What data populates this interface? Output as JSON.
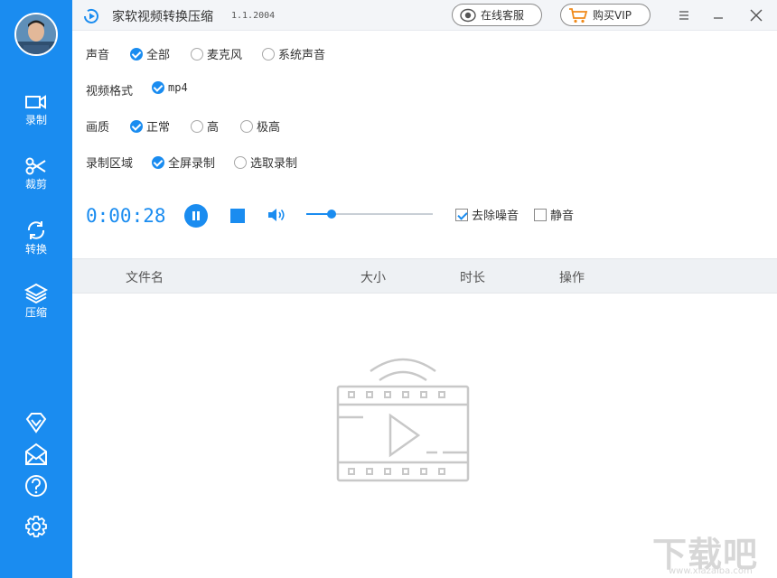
{
  "sidebar": {
    "items": [
      {
        "label": "录制",
        "icon": "camera-icon"
      },
      {
        "label": "裁剪",
        "icon": "scissors-icon"
      },
      {
        "label": "转换",
        "icon": "convert-icon"
      },
      {
        "label": "压缩",
        "icon": "layers-icon"
      }
    ],
    "bottom_icons": [
      "diamond-icon",
      "mail-icon",
      "help-icon",
      "settings-icon"
    ]
  },
  "titlebar": {
    "title": "家软视频转换压缩",
    "version": "1.1.2004",
    "support_button": "在线客服",
    "vip_button": "购买VIP"
  },
  "options": {
    "audio": {
      "label": "声音",
      "choices": [
        "全部",
        "麦克风",
        "系统声音"
      ],
      "selected": "全部"
    },
    "format": {
      "label": "视频格式",
      "choices": [
        "mp4"
      ],
      "selected": "mp4"
    },
    "quality": {
      "label": "画质",
      "choices": [
        "正常",
        "高",
        "极高"
      ],
      "selected": "正常"
    },
    "area": {
      "label": "录制区域",
      "choices": [
        "全屏录制",
        "选取录制"
      ],
      "selected": "全屏录制"
    }
  },
  "recording": {
    "timer": "0:00:28",
    "volume_fraction": 0.2,
    "denoise_label": "去除噪音",
    "denoise_checked": true,
    "mute_label": "静音",
    "mute_checked": false
  },
  "table": {
    "columns": [
      "文件名",
      "大小",
      "时长",
      "操作"
    ],
    "rows": []
  },
  "watermark": {
    "text": "下载吧",
    "url": "www.xiazaiba.com"
  },
  "colors": {
    "accent": "#1a8cf0",
    "titlebar_bg": "#f3f5f8",
    "header_bg": "#eef1f4"
  }
}
